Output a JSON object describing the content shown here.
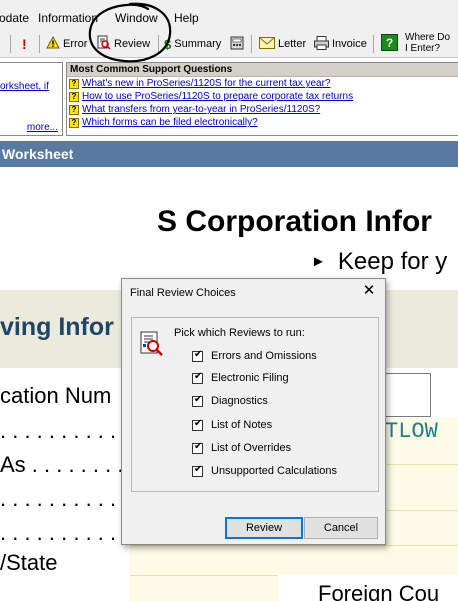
{
  "menubar": {
    "items": [
      "odate",
      "Information",
      "Window",
      "Help"
    ]
  },
  "toolbar": {
    "error_label": "Error",
    "review_label": "Review",
    "summary_label": "Summary",
    "letter_label": "Letter",
    "invoice_label": "Invoice",
    "wheredo_line1": "Where Do",
    "wheredo_line2": "I Enter?"
  },
  "left_panel": {
    "link": "orksheet, if",
    "more": "more..."
  },
  "support_panel": {
    "heading": "Most Common Support Questions",
    "questions": [
      "What's new in ProSeries/1120S for the current tax year?",
      "How to use ProSeries/1120S to prepare corporate tax returns",
      "What transfers from year-to-year in ProSeries/1120S?",
      "Which forms can be filed electronically?"
    ]
  },
  "worksheet": {
    "header": "Worksheet",
    "title": "S Corporation Infor",
    "subtitle": "Keep for y",
    "section_title": "ving Infor",
    "labels": [
      "cation Num",
      ". . . . . . . . . . . . . . .",
      "As . . . . . . . . . . .",
      ". . . . . . . . . . . . . . .",
      ". . . . . . . . . . . . . . .",
      "/State"
    ],
    "teal_value": "TLOW",
    "foreign_label": "Foreign Cou"
  },
  "dialog": {
    "title": "Final Review Choices",
    "prompt": "Pick which Reviews to run:",
    "options": [
      {
        "label": "Errors and Omissions",
        "checked": true
      },
      {
        "label": "Electronic Filing",
        "checked": true
      },
      {
        "label": "Diagnostics",
        "checked": true
      },
      {
        "label": "List of Notes",
        "checked": true
      },
      {
        "label": "List of Overrides",
        "checked": true
      },
      {
        "label": "Unsupported Calculations",
        "checked": true
      }
    ],
    "review_button": "Review",
    "cancel_button": "Cancel"
  },
  "colors": {
    "worksheet_bar": "#587aa1",
    "section_title": "#20456b",
    "teal_text": "#1c7f89",
    "link": "#0000cc"
  }
}
